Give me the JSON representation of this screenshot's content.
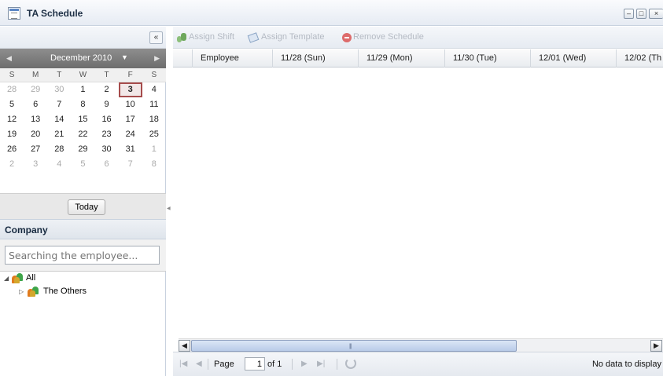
{
  "window": {
    "title": "TA Schedule",
    "controls": [
      "minimize",
      "maximize",
      "close"
    ]
  },
  "left_panel": {
    "collapse_glyph": "«",
    "calendar": {
      "month_label": "December 2010",
      "weekdays": [
        "S",
        "M",
        "T",
        "W",
        "T",
        "F",
        "S"
      ],
      "weeks": [
        [
          "28",
          "29",
          "30",
          "1",
          "2",
          "3",
          "4"
        ],
        [
          "5",
          "6",
          "7",
          "8",
          "9",
          "10",
          "11"
        ],
        [
          "12",
          "13",
          "14",
          "15",
          "16",
          "17",
          "18"
        ],
        [
          "19",
          "20",
          "21",
          "22",
          "23",
          "24",
          "25"
        ],
        [
          "26",
          "27",
          "28",
          "29",
          "30",
          "31",
          "1"
        ],
        [
          "2",
          "3",
          "4",
          "5",
          "6",
          "7",
          "8"
        ]
      ],
      "selected_day": "3",
      "today_label": "Today"
    },
    "company": {
      "header": "Company",
      "search_placeholder": "Searching the employee...",
      "tree": [
        {
          "label": "All",
          "expanded": true
        },
        {
          "label": "The Others",
          "expanded": false
        }
      ]
    }
  },
  "toolbar": {
    "assign_shift": "Assign Shift",
    "assign_template": "Assign Template",
    "remove_schedule": "Remove Schedule"
  },
  "grid": {
    "columns": [
      "Employee",
      "11/28 (Sun)",
      "11/29 (Mon)",
      "11/30 (Tue)",
      "12/01 (Wed)",
      "12/02 (Th"
    ],
    "rows": []
  },
  "pager": {
    "page_label": "Page",
    "page_value": "1",
    "of_label": "of 1",
    "status": "No data to display"
  }
}
